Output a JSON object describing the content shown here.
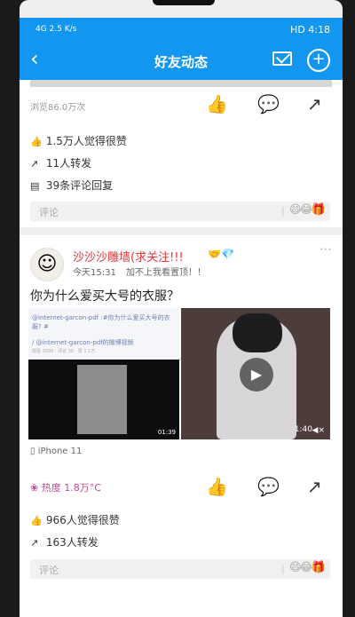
{
  "status": {
    "left": "4G 2.5 K/s",
    "right": "HD 4:18"
  },
  "header": {
    "title": "好友动态",
    "back_icon": "back-arrow-icon",
    "mail_icon": "mail-icon",
    "add_icon": "plus-icon"
  },
  "post1": {
    "views": "浏览86.0万次",
    "likes": "1.5万人觉得很赞",
    "reposts": "11人转发",
    "comments": "39条评论回复",
    "comment_placeholder": "评论",
    "emojis": "😄😂🎁"
  },
  "post2": {
    "username": "沙沙沙雕墙(求关注!!!",
    "badges": "🤝💎",
    "time": "今天15:31",
    "note": "加不上我看置顶！！",
    "text": "你为什么爱买大号的衣服？",
    "left_image": {
      "line1": "@internet-garcon-pdf :#你为什么爱买大号的衣服? #",
      "line2": "/ @internet-garcon-pdf的微博视频",
      "line3": "观看 3000 · 评论 30 · 赞 1.1万",
      "duration": "01:39"
    },
    "right_image": {
      "duration": "1:40"
    },
    "device": "iPhone 11",
    "heat": "热度 1.8万°C",
    "likes": "966人觉得很赞",
    "reposts": "163人转发",
    "comment_placeholder": "评论",
    "emojis": "😄😂🎁"
  }
}
